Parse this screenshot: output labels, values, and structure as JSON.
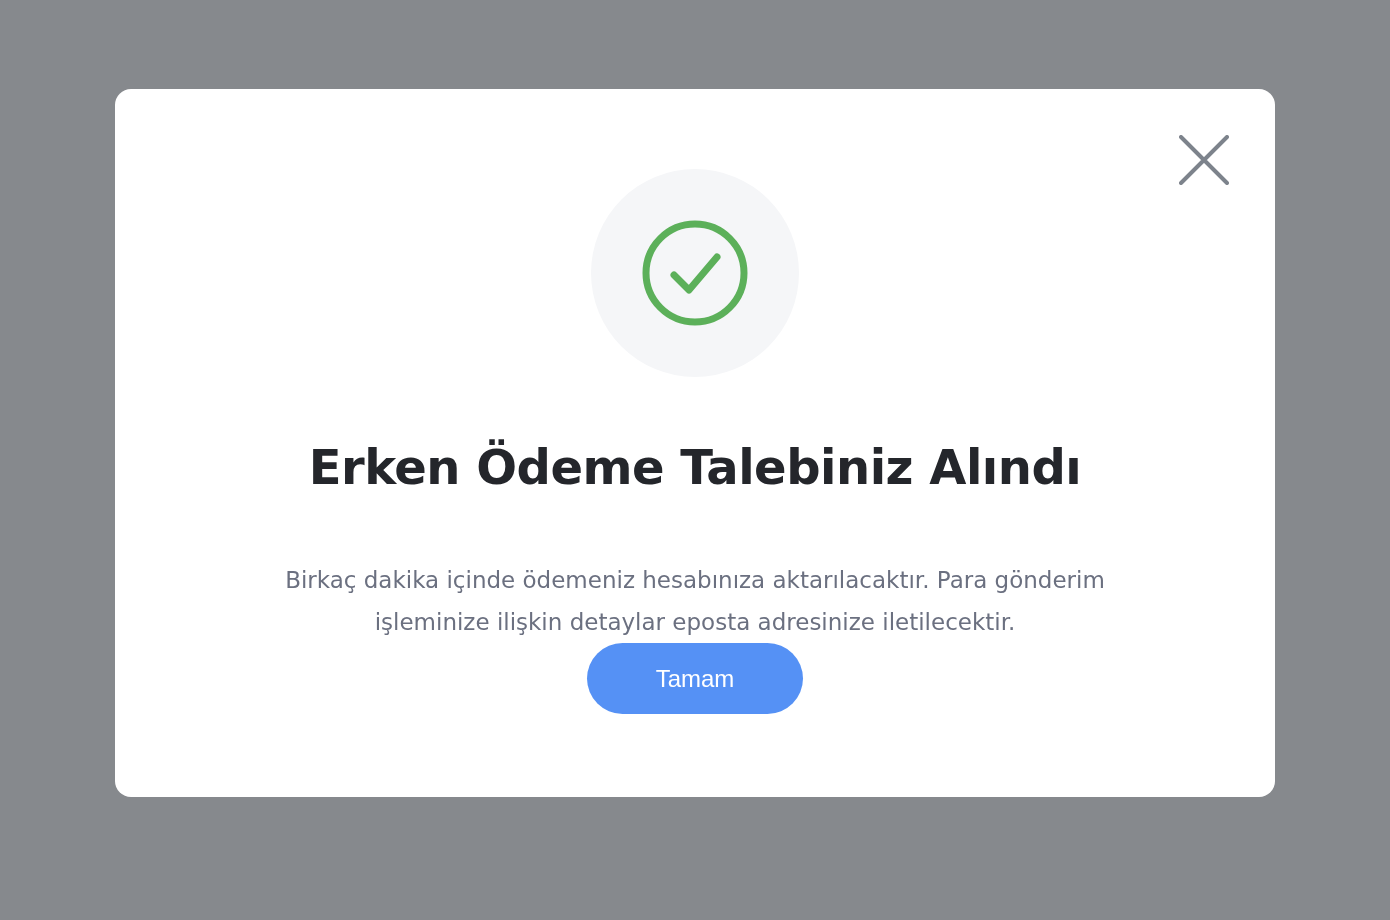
{
  "dialog": {
    "success": true,
    "title": "Erken Ödeme Talebiniz Alındı",
    "message": "Birkaç dakika içinde ödemeniz hesabınıza aktarılacaktır. Para gönderim işleminize ilişkin detaylar eposta adresinize iletilecektir.",
    "button": "Tamam"
  }
}
